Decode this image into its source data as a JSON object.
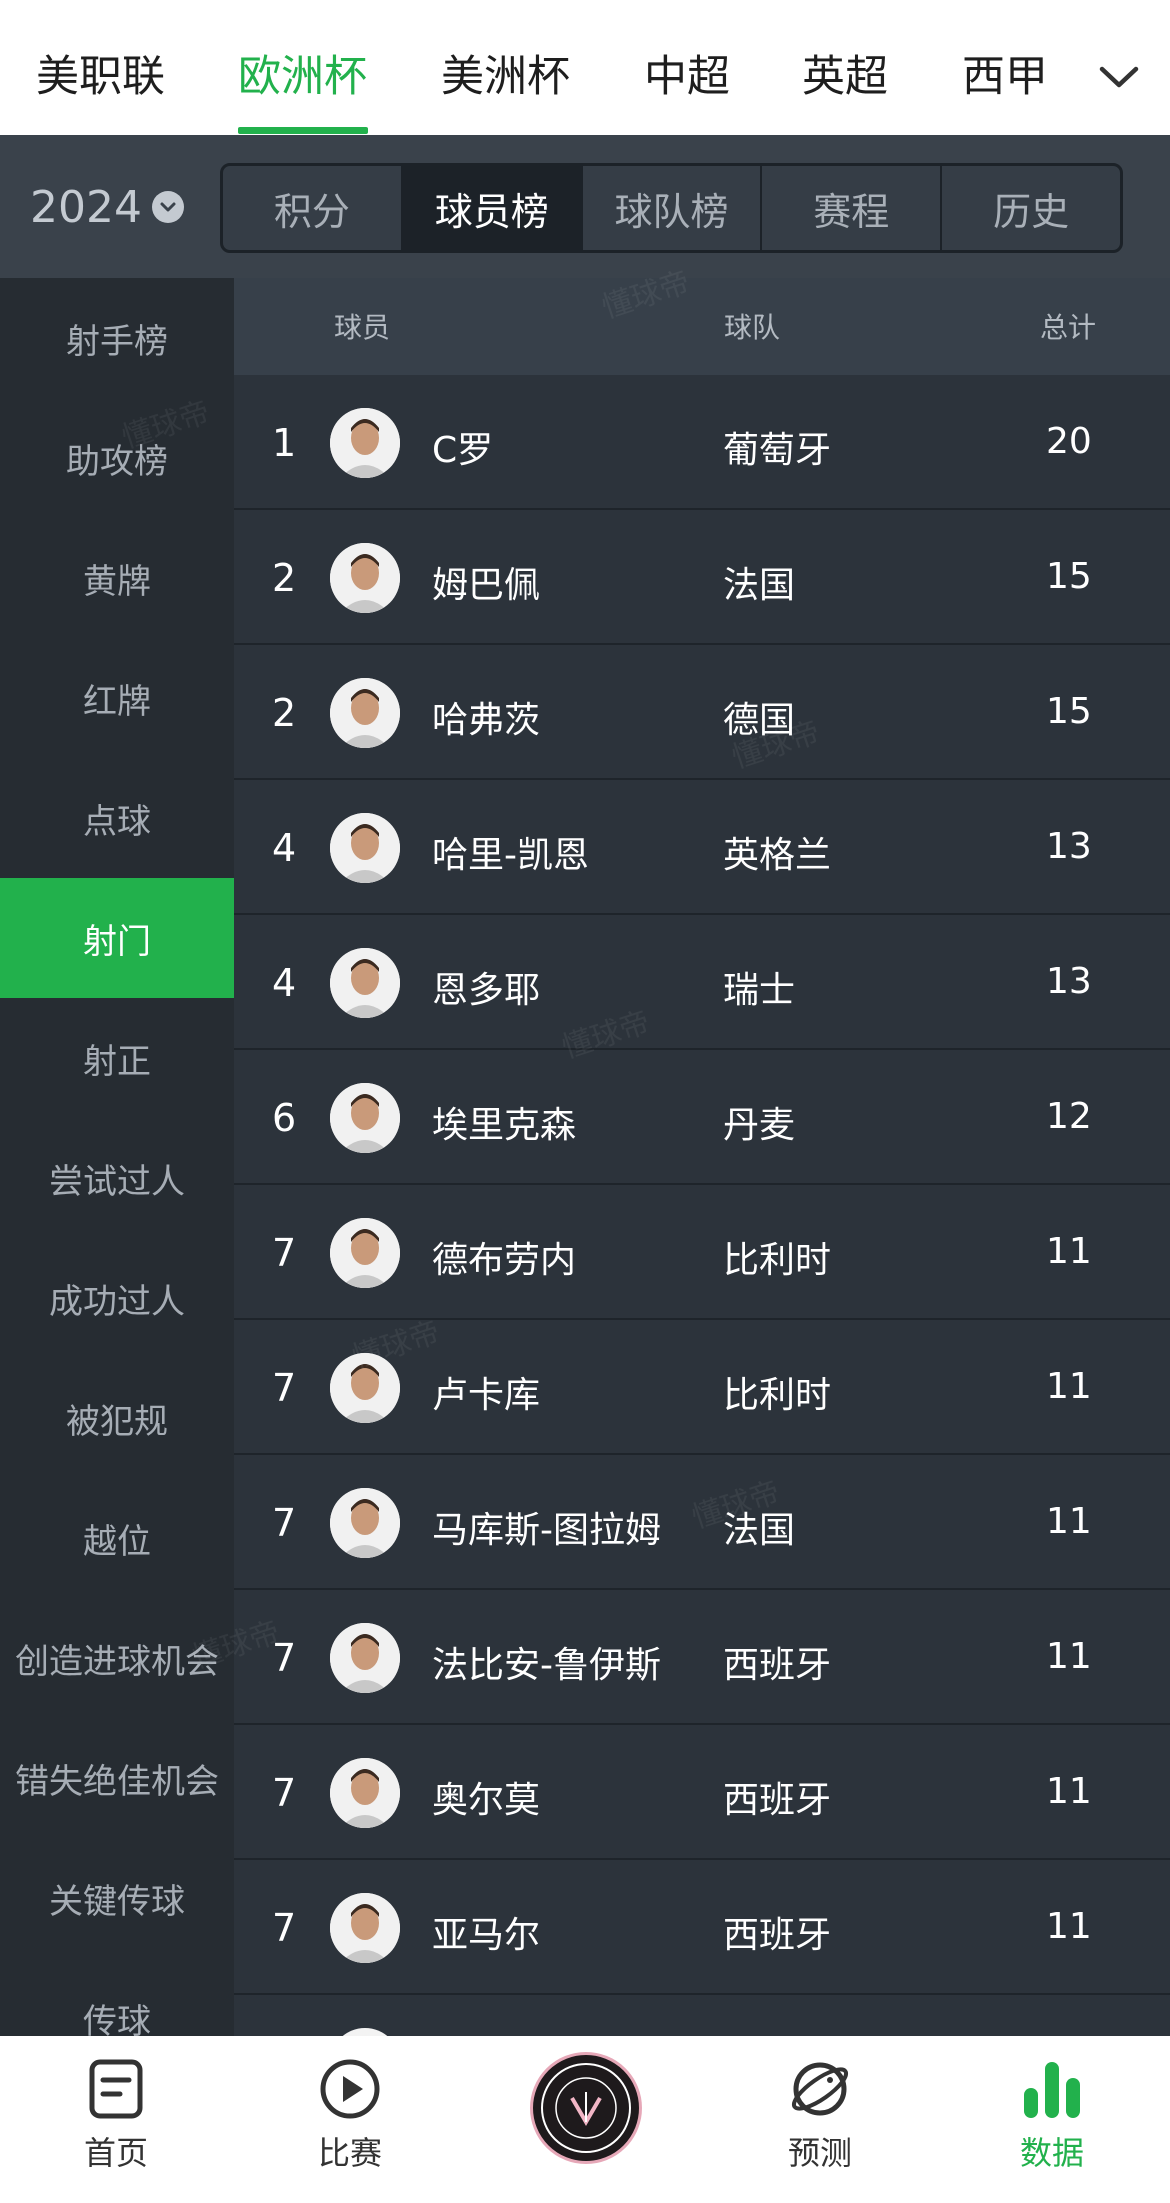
{
  "league_tabs": [
    {
      "label": "美职联",
      "active": false
    },
    {
      "label": "欧洲杯",
      "active": true
    },
    {
      "label": "美洲杯",
      "active": false
    },
    {
      "label": "中超",
      "active": false
    },
    {
      "label": "英超",
      "active": false
    },
    {
      "label": "西甲",
      "active": false
    }
  ],
  "more_icon": "chevron-down-icon",
  "year": "2024",
  "segments": [
    {
      "label": "积分",
      "active": false
    },
    {
      "label": "球员榜",
      "active": true
    },
    {
      "label": "球队榜",
      "active": false
    },
    {
      "label": "赛程",
      "active": false
    },
    {
      "label": "历史",
      "active": false
    }
  ],
  "sidebar": [
    {
      "label": "射手榜",
      "active": false
    },
    {
      "label": "助攻榜",
      "active": false
    },
    {
      "label": "黄牌",
      "active": false
    },
    {
      "label": "红牌",
      "active": false
    },
    {
      "label": "点球",
      "active": false
    },
    {
      "label": "射门",
      "active": true
    },
    {
      "label": "射正",
      "active": false
    },
    {
      "label": "尝试过人",
      "active": false
    },
    {
      "label": "成功过人",
      "active": false
    },
    {
      "label": "被犯规",
      "active": false
    },
    {
      "label": "越位",
      "active": false
    },
    {
      "label": "创造进球机会",
      "active": false
    },
    {
      "label": "错失绝佳机会",
      "active": false
    },
    {
      "label": "关键传球",
      "active": false
    },
    {
      "label": "传球",
      "active": false
    }
  ],
  "table": {
    "headers": {
      "player": "球员",
      "team": "球队",
      "total": "总计"
    },
    "rows": [
      {
        "rank": "1",
        "name": "C罗",
        "team": "葡萄牙",
        "total": "20"
      },
      {
        "rank": "2",
        "name": "姆巴佩",
        "team": "法国",
        "total": "15"
      },
      {
        "rank": "2",
        "name": "哈弗茨",
        "team": "德国",
        "total": "15"
      },
      {
        "rank": "4",
        "name": "哈里-凯恩",
        "team": "英格兰",
        "total": "13"
      },
      {
        "rank": "4",
        "name": "恩多耶",
        "team": "瑞士",
        "total": "13"
      },
      {
        "rank": "6",
        "name": "埃里克森",
        "team": "丹麦",
        "total": "12"
      },
      {
        "rank": "7",
        "name": "德布劳内",
        "team": "比利时",
        "total": "11"
      },
      {
        "rank": "7",
        "name": "卢卡库",
        "team": "比利时",
        "total": "11"
      },
      {
        "rank": "7",
        "name": "马库斯-图拉姆",
        "team": "法国",
        "total": "11"
      },
      {
        "rank": "7",
        "name": "法比安-鲁伊斯",
        "team": "西班牙",
        "total": "11"
      },
      {
        "rank": "7",
        "name": "奥尔莫",
        "team": "西班牙",
        "total": "11"
      },
      {
        "rank": "7",
        "name": "亚马尔",
        "team": "西班牙",
        "total": "11"
      }
    ]
  },
  "bottom_nav": [
    {
      "label": "首页",
      "icon": "home-doc-icon",
      "active": false
    },
    {
      "label": "比赛",
      "icon": "play-icon",
      "active": false
    },
    {
      "label": "预测",
      "icon": "planet-icon",
      "active": false
    },
    {
      "label": "数据",
      "icon": "bar-chart-icon",
      "active": true
    }
  ],
  "watermark": "懂球帝",
  "colors": {
    "accent": "#22b14c",
    "background": "#2c333b",
    "sidebar": "#262c32"
  }
}
